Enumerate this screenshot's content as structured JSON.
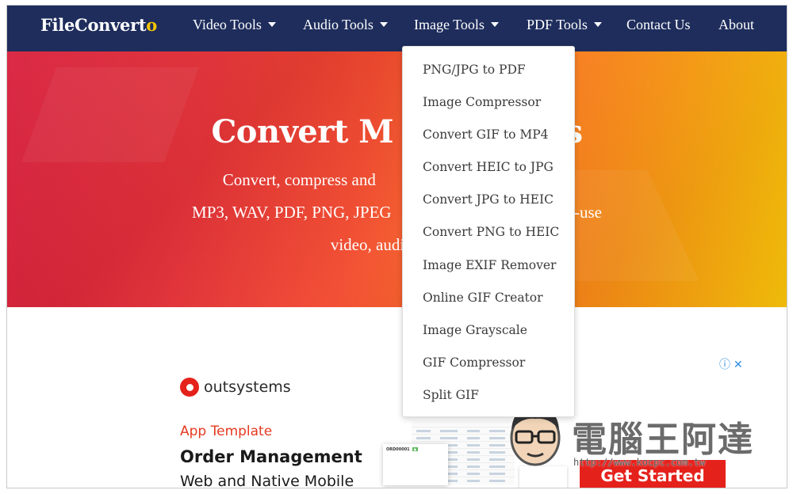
{
  "nav": {
    "logo_main": "FileConvert",
    "logo_accent": "o",
    "items": [
      {
        "label": "Video Tools",
        "has_caret": true
      },
      {
        "label": "Audio Tools",
        "has_caret": true
      },
      {
        "label": "Image Tools",
        "has_caret": true
      },
      {
        "label": "PDF Tools",
        "has_caret": true
      },
      {
        "label": "Contact Us",
        "has_caret": false
      },
      {
        "label": "About",
        "has_caret": false
      }
    ]
  },
  "hero": {
    "title": "Convert M          Files",
    "line1": "Convert, compress and                          (MP4, MOV,",
    "line2": "MP3, WAV, PDF, PNG, JPEG                          our easy-to-use",
    "line3": "video, audi"
  },
  "dropdown": {
    "items": [
      "PNG/JPG to PDF",
      "Image Compressor",
      "Convert GIF to MP4",
      "Convert HEIC to JPG",
      "Convert JPG to HEIC",
      "Convert PNG to HEIC",
      "Image EXIF Remover",
      "Online GIF Creator",
      "Image Grayscale",
      "GIF Compressor",
      "Split GIF"
    ]
  },
  "ad": {
    "brand": "outsystems",
    "kicker": "App Template",
    "title": "Order Management",
    "subtitle": "Web and Native Mobile",
    "cta": "Get Started Now",
    "info_icon": "ⓘ",
    "close_icon": "✕",
    "card_id": "ORD00001",
    "card_status": "●"
  },
  "watermark": {
    "text": "電腦王阿達",
    "url": "http://www.kocpc.com.tw"
  },
  "colors": {
    "navbar": "#1e2d5c",
    "accent": "#f7c500",
    "ad_red": "#e5211c"
  }
}
